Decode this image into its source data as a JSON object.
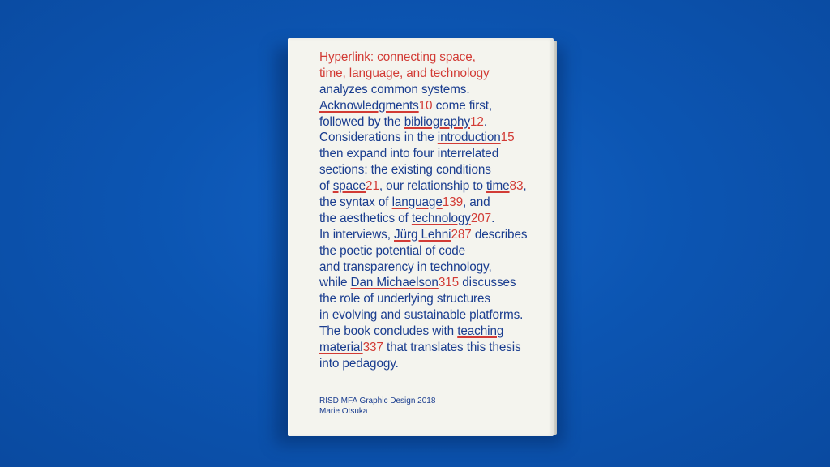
{
  "title_lines": [
    "Hyperlink: connecting space,",
    "time, language, and technology"
  ],
  "line3": "analyzes common systems.",
  "acknowledgments": {
    "link": "Acknowledgments",
    "num": "10",
    "rest": " come first,"
  },
  "bibliography": {
    "pre": "followed by the ",
    "link": "bibliography",
    "num": "12",
    "rest": "."
  },
  "introduction": {
    "pre": "Considerations in the ",
    "link": "introduction",
    "num": "15"
  },
  "line7": "then expand into four interrelated",
  "line8": "sections: the existing conditions",
  "space_time": {
    "pre": "of ",
    "link1": "space",
    "num1": "21",
    "mid": ", our relationship to ",
    "link2": "time",
    "num2": "83",
    "rest": ","
  },
  "language": {
    "pre": "the syntax of ",
    "link": "language",
    "num": "139",
    "rest": ", and"
  },
  "technology": {
    "pre": "the aesthetics of ",
    "link": "technology",
    "num": "207",
    "rest": "."
  },
  "lehni": {
    "pre": "In interviews, ",
    "link": "Jürg Lehni",
    "num": "287",
    "rest": " describes"
  },
  "line13": "the poetic potential of code",
  "line14": "and transparency in technology,",
  "michaelson": {
    "pre": "while ",
    "link": "Dan Michaelson",
    "num": "315",
    "rest": " discusses"
  },
  "line16": "the role of underlying structures",
  "line17": "in evolving and sustainable platforms.",
  "teaching": {
    "pre": "The book concludes with ",
    "link": "teaching"
  },
  "material": {
    "link": "material",
    "num": "337",
    "rest": " that translates this thesis"
  },
  "line20": "into pedagogy.",
  "footer": {
    "line1": "RISD MFA Graphic Design 2018",
    "line2": "Marie Otsuka"
  },
  "colors": {
    "background": "#0d55b3",
    "page": "#f4f4ee",
    "blue_text": "#1a3d8f",
    "red_text": "#d23b35"
  }
}
